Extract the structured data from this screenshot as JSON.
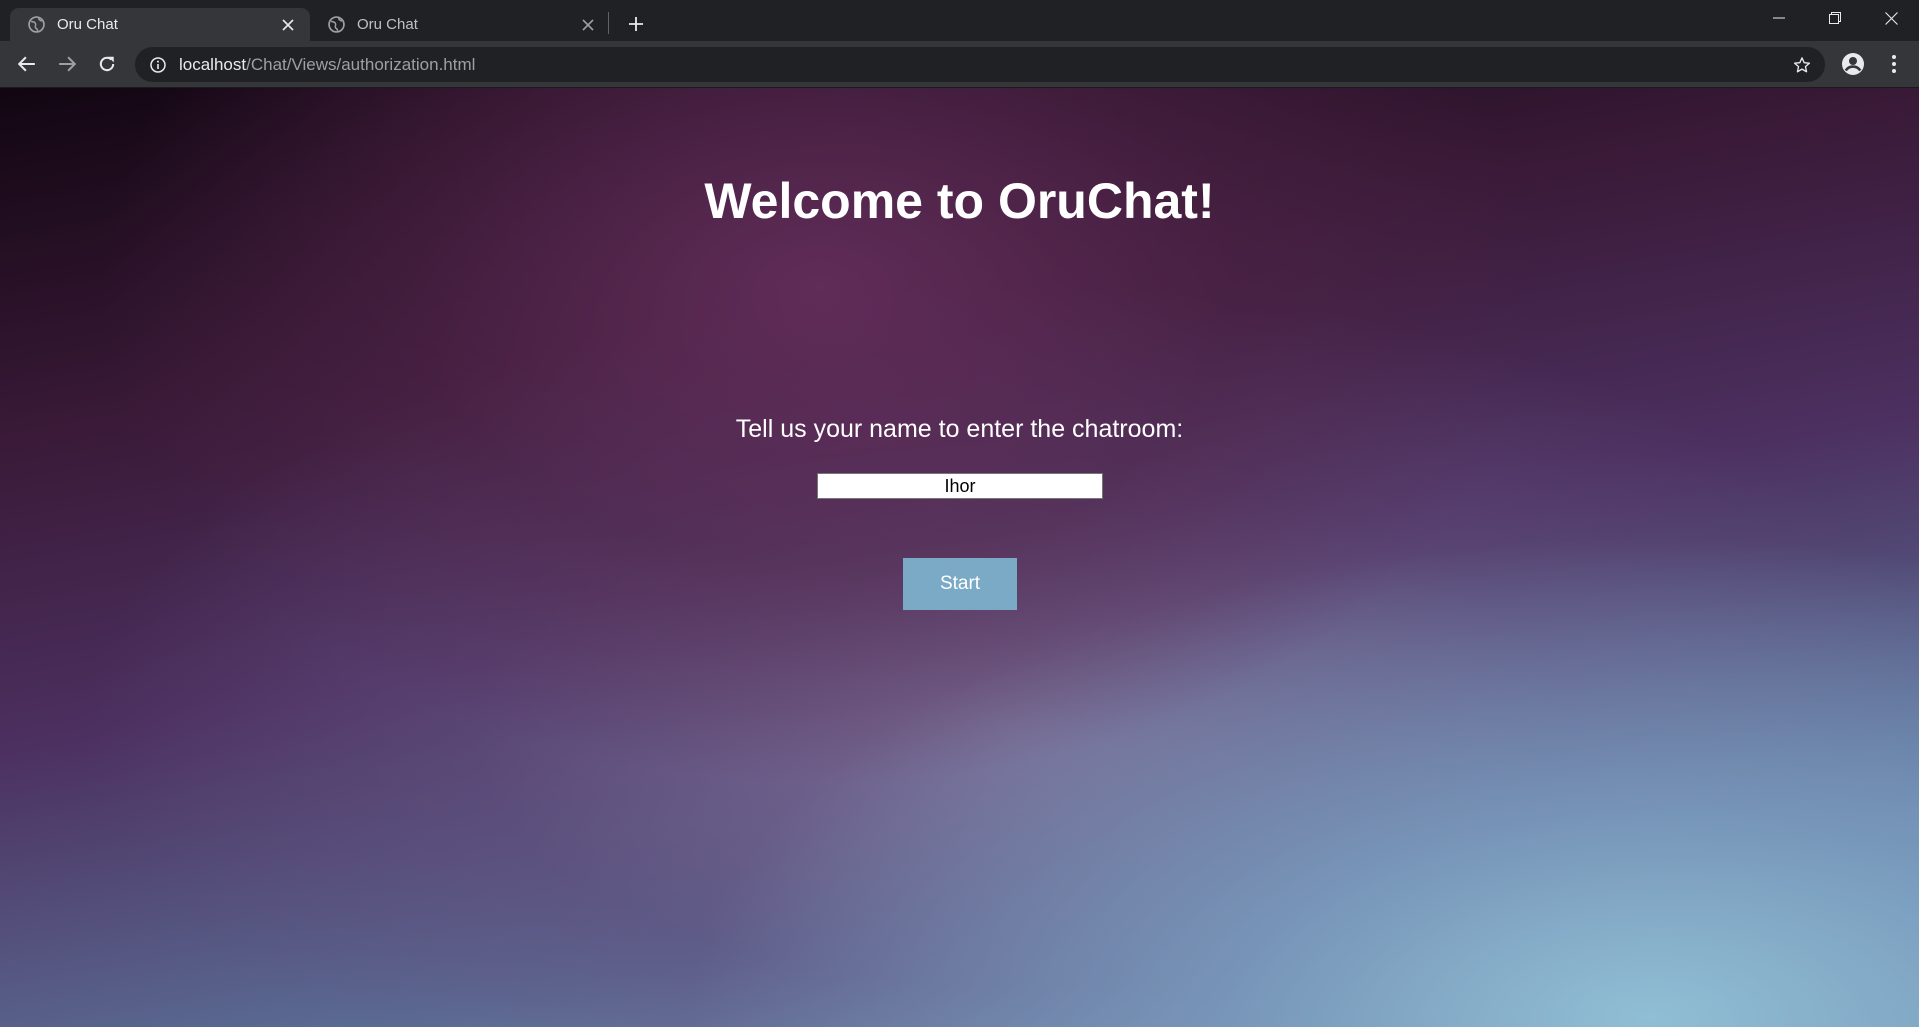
{
  "browser": {
    "tabs": [
      {
        "title": "Oru Chat",
        "active": true,
        "favicon": "globe-icon"
      },
      {
        "title": "Oru Chat",
        "active": false,
        "favicon": "globe-icon"
      }
    ],
    "address_bar": {
      "host": "localhost",
      "path": "/Chat/Views/authorization.html"
    },
    "colors": {
      "tabstrip": "#202124",
      "toolbar": "#35363a",
      "omnibox": "#202124"
    }
  },
  "page": {
    "heading": "Welcome to OruChat!",
    "prompt": "Tell us your name to enter the chatroom:",
    "name_input_value": "Ihor",
    "start_label": "Start",
    "colors": {
      "button": "#7aaac6",
      "text": "#ffffff"
    }
  }
}
